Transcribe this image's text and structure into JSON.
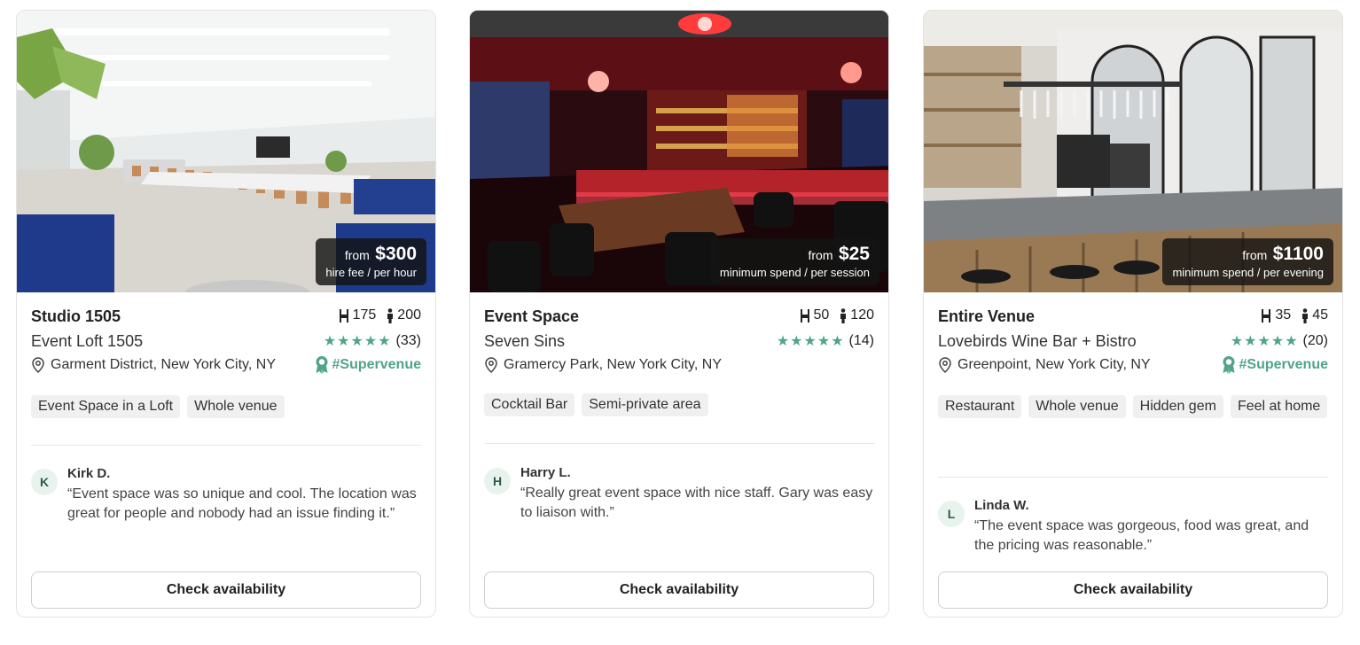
{
  "cards": [
    {
      "price": {
        "from": "from",
        "amount": "$300",
        "unit": "hire fee / per hour"
      },
      "title": "Studio 1505",
      "seated": "175",
      "standing": "200",
      "subtitle": "Event Loft 1505",
      "stars": "★★★★★",
      "reviews_count": "(33)",
      "location": "Garment District, New York City, NY",
      "badge": "#Supervenue",
      "tags": [
        "Event Space in a Loft",
        "Whole venue"
      ],
      "review": {
        "initial": "K",
        "name": "Kirk D.",
        "text": "“Event space was so unique and cool. The location was great for people and nobody had an issue finding it.”"
      },
      "cta": "Check availability"
    },
    {
      "price": {
        "from": "from",
        "amount": "$25",
        "unit": "minimum spend / per session"
      },
      "title": "Event Space",
      "seated": "50",
      "standing": "120",
      "subtitle": "Seven Sins",
      "stars": "★★★★★",
      "reviews_count": "(14)",
      "location": "Gramercy Park, New York City, NY",
      "badge": "",
      "tags": [
        "Cocktail Bar",
        "Semi-private area"
      ],
      "review": {
        "initial": "H",
        "name": "Harry L.",
        "text": "“Really great event space with nice staff. Gary was easy to liaison with.”"
      },
      "cta": "Check availability"
    },
    {
      "price": {
        "from": "from",
        "amount": "$1100",
        "unit": "minimum spend / per evening"
      },
      "title": "Entire Venue",
      "seated": "35",
      "standing": "45",
      "subtitle": "Lovebirds Wine Bar + Bistro",
      "stars": "★★★★★",
      "reviews_count": "(20)",
      "location": "Greenpoint, New York City, NY",
      "badge": "#Supervenue",
      "tags": [
        "Restaurant",
        "Whole venue",
        "Hidden gem",
        "Feel at home"
      ],
      "review": {
        "initial": "L",
        "name": "Linda W.",
        "text": "“The event space was gorgeous, food was great, and the pricing was reasonable.”"
      },
      "cta": "Check availability"
    }
  ],
  "colors": {
    "accent": "#4fa585",
    "price_bg": "#141414",
    "tag_bg": "#f0f0f0"
  },
  "icons": {
    "seated": "chair-icon",
    "standing": "person-icon",
    "location": "map-pin-icon",
    "badge": "award-ribbon-icon"
  }
}
